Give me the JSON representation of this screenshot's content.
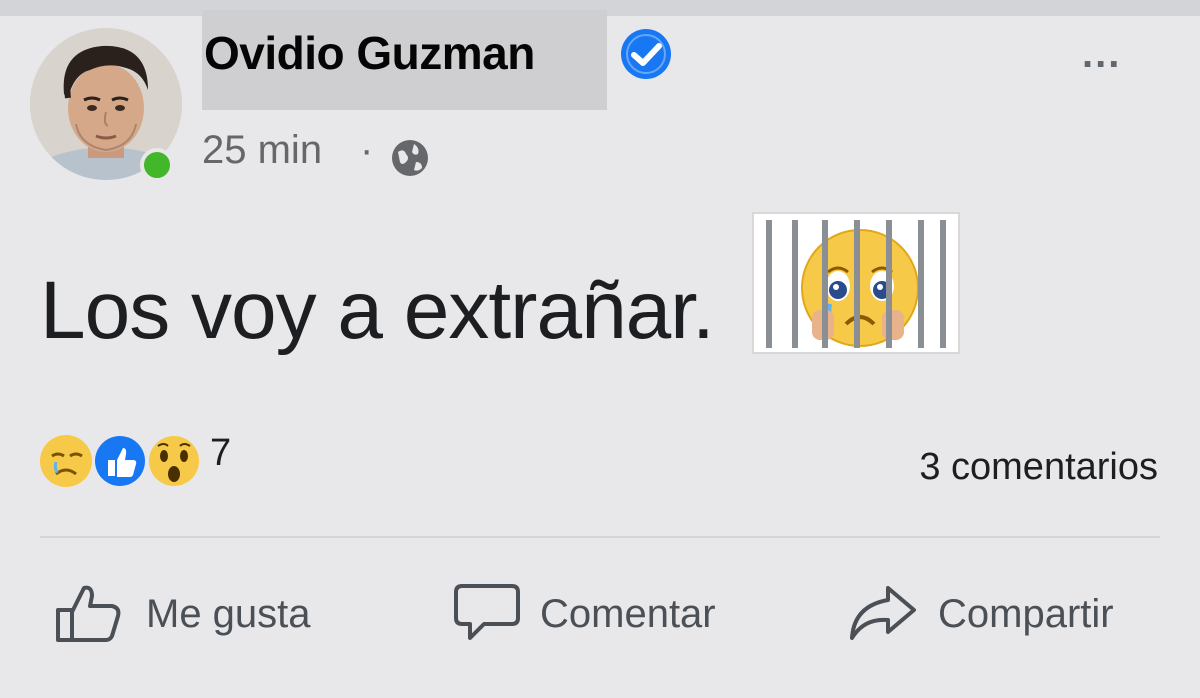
{
  "post": {
    "author": "Ovidio Guzman",
    "time": "25 min",
    "separator": "·",
    "text": "Los voy a extrañar.",
    "more_label": "...",
    "reactions_count": "7",
    "comments_count": "3 comentarios"
  },
  "actions": {
    "like_label": "Me gusta",
    "comment_label": "Comentar",
    "share_label": "Compartir"
  },
  "icons": [
    "verified-badge-icon",
    "globe-icon",
    "sad-face-reaction-icon",
    "like-reaction-icon",
    "wow-reaction-icon",
    "thumbs-up-icon",
    "comment-bubble-icon",
    "share-arrow-icon",
    "jailed-crying-emoji"
  ],
  "colors": {
    "verified": "#1877f2",
    "online": "#42b72a",
    "like": "#1877f2",
    "reaction_yellow": "#f7c948"
  }
}
